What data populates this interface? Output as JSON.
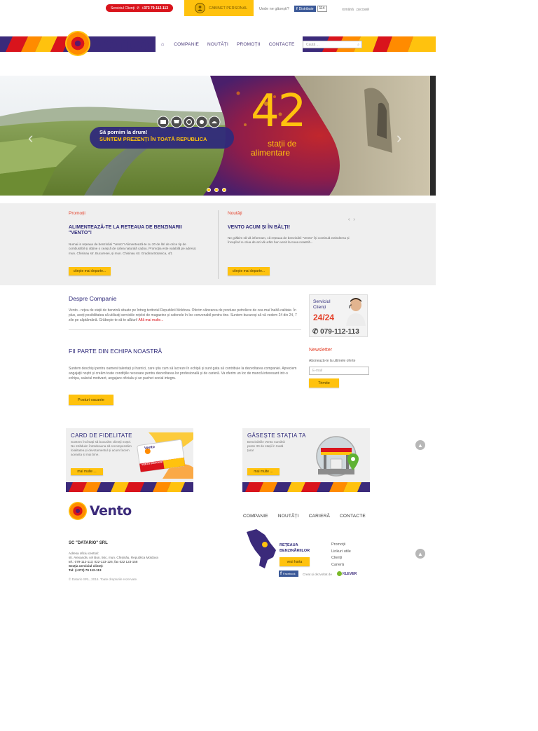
{
  "topbar": {
    "service_label": "Serviciul Clienți",
    "service_phone": "+373 79-112-113",
    "cabinet_label": "CABINET PERSONAL",
    "where_label": "Unde ne găsești?",
    "fb_button": "Distribuie",
    "fb_count": "114",
    "lang_ro": "română",
    "lang_ru": "русский"
  },
  "brand": {
    "name": "Vento",
    "orange": "#ff8b00",
    "yellow": "#ffc20e",
    "red": "#d9141c",
    "purple": "#3b2a7a"
  },
  "nav": {
    "home_icon": "home-icon",
    "items": [
      "COMPANIE",
      "NOUTĂȚI",
      "PROMOȚII",
      "CONTACTE"
    ],
    "search_placeholder": "Caută ..."
  },
  "hero": {
    "tagline_1": "Să pornim la drum!",
    "tagline_2": "SUNTEM PREZENȚI ÎN TOATĂ REPUBLICA",
    "big_number": "42",
    "big_text_1": "stații de",
    "big_text_2": "alimentare",
    "slide_count": 3
  },
  "news": {
    "promo": {
      "head": "Promoții",
      "title": "ALIMENTEAZĂ-TE LA RETEAUA DE BENZINARII \"VENTO\"!",
      "body": "Numai in rețeaua de benzinării \"Vento\"! Alimentează-te cu 20 de litri de orice tip de combustibil și obține o ceașcă de cafea naturală cadou. Promoția este valabilă pe adresa: mun. Chisinau str. Bucuresei, și mun. Chisinau str. Gradina Botanica, 4/1",
      "button": "citește mai departe..."
    },
    "news": {
      "head": "Noutăți",
      "title": "VENTO ACUM ȘI ÎN BĂLȚI!",
      "body": "Ne grăbim să vă informam, că rețeaua de benzinării \"Vento\" își continuă extinderea și începînd cu ziua de azi vă urăm bun venit la noua noastră...",
      "button": "citește mai departe..."
    },
    "prev": "‹",
    "next": "›"
  },
  "about": {
    "title": "Despre Companie",
    "body": "Vento - rețea de stații de benzină situate pe întreg teritoriul Republicii Moldova. Oferim vânzarea de produse petroliere de cea mai înaltă calitate. În plus, aveți posibilitatea să utilizați serviciile rețelei de magazine și cafenele în loc convenabil pentru tine. Suntem bucuroși să vă vedem 24 din 24, 7 zile pe săptămână. Grăbește-te să te alături!",
    "link": "Află mai multe..."
  },
  "team": {
    "title": "FII PARTE DIN ECHIPA NOASTRĂ",
    "body": "Suntem deschiși pentru oameni talentați și harnici, care știu cum să lucreze în echipă și sunt gata să contribuie la dezvoltarea companiei. Apreciem angajații noștri și creăm toate condițiile necesare pentru dezvoltarea lor profesională și de carieră. Va oferim un loc de muncă interesant intr-o echipa, salariul motivant, angajare oficiala și un pachet social integru.",
    "button": "Posturi vacante"
  },
  "service": {
    "label_1": "Serviciul",
    "label_2": "Clienți",
    "hours": "24/24",
    "phone": "079-112-113"
  },
  "newsletter": {
    "title": "Newsletter",
    "subtitle": "Abonează-te la ultimele oferte",
    "placeholder": "E-mail",
    "button": "Trimite"
  },
  "cards": {
    "loyalty": {
      "title": "CARD DE FIDELITATE",
      "body": "Suntem încîntați să bucurăm clienții noștri. Ne străduim întotdeauna să recompensăm loialitatea și devotamentul și acum facem aceasta și mai bine.",
      "button": "mai multe ...",
      "card_text": "VENTO DISCOUNT"
    },
    "station": {
      "title": "GĂSEȘTE STAȚIA TA",
      "body": "Benzinăriile Vento numără peste 30 de stații în toată țara!",
      "button": "mai multe ..."
    }
  },
  "footer": {
    "nav": [
      "COMPANIE",
      "NOUTĂȚI",
      "CARIERĂ",
      "CONTACTE"
    ],
    "company": "SC \"DATARIO\" SRL",
    "address_label": "Adresa oficiu central:",
    "address": "str. Alexandru cel Bun, 56c, mun. Chișinău, Republica Moldova",
    "phones": "tel.: 079-112-113; 022-123-126;   fax 022 123-158",
    "dept": "Secția serviciul clienți:",
    "dept_phone": "Tel: (+373) 79 112-113",
    "copyright": "© Datario SRL, 2016. Toate drepturile rezervate.",
    "network_title_1": "REȚEAUA",
    "network_title_2": "BENZINĂRIILOR",
    "map_button": "vezi harta",
    "links": [
      "Promoții",
      "Linkuri utile",
      "Clienți",
      "Carieră"
    ],
    "fb_badge": "Facebook",
    "created_by": "Creat și dezvoltat de",
    "agency": "KLEVER"
  }
}
